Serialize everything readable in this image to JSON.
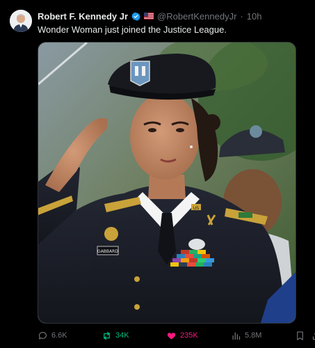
{
  "post": {
    "author_name": "Robert F. Kennedy Jr",
    "handle": "@RobertKennedyJr",
    "separator": "·",
    "time": "10h",
    "text": "Wonder Woman just joined the Justice League."
  },
  "uniform": {
    "name_tag": "GABBARD",
    "insignia": "US"
  },
  "actions": {
    "replies": "6.6K",
    "reposts": "34K",
    "likes": "235K",
    "views": "5.8M"
  },
  "colors": {
    "background": "#000000",
    "text": "#e7e9ea",
    "muted": "#71767b",
    "verified": "#1d9bf0",
    "repost": "#00ba7c",
    "like": "#f91880"
  },
  "icons": [
    "verified-badge-icon",
    "flag-icon",
    "reply-icon",
    "repost-icon",
    "heart-icon",
    "views-icon",
    "bookmark-icon",
    "share-icon"
  ]
}
